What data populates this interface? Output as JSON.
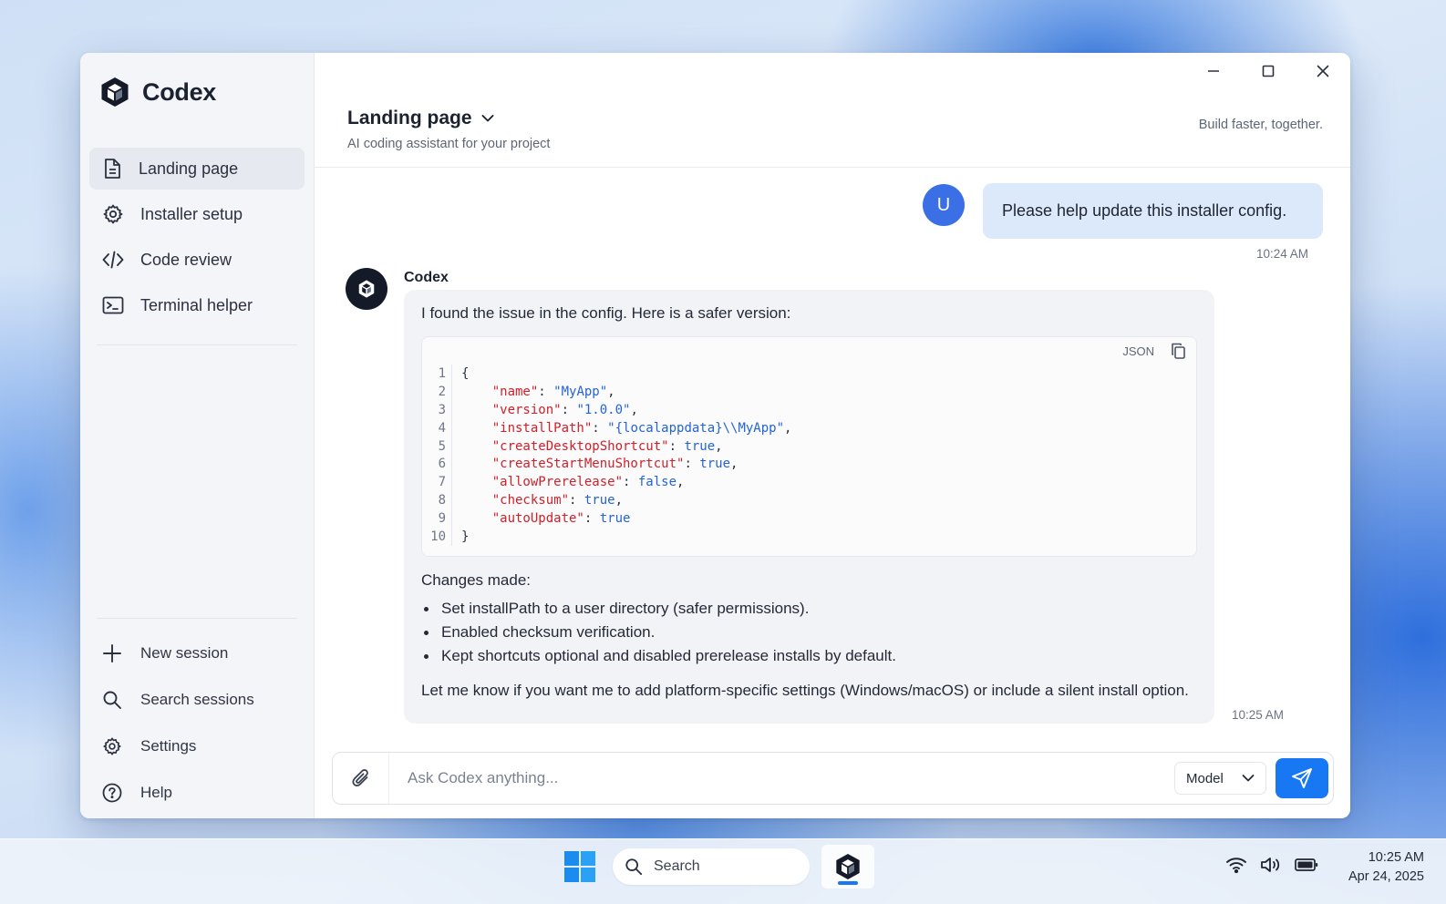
{
  "app": {
    "name": "Codex",
    "brand_color": "#141a27",
    "accent_color": "#1877f2"
  },
  "sidebar": {
    "nav": [
      {
        "label": "Landing page",
        "icon": "document-icon",
        "active": true
      },
      {
        "label": "Installer setup",
        "icon": "gear-icon",
        "active": false
      },
      {
        "label": "Code review",
        "icon": "code-icon",
        "active": false
      },
      {
        "label": "Terminal helper",
        "icon": "terminal-icon",
        "active": false
      }
    ],
    "bottom": [
      {
        "label": "New session",
        "icon": "plus-icon"
      },
      {
        "label": "Search sessions",
        "icon": "search-icon"
      },
      {
        "label": "Settings",
        "icon": "gear-icon"
      },
      {
        "label": "Help",
        "icon": "help-circle-icon"
      }
    ]
  },
  "header": {
    "title": "Landing page",
    "subtitle": "AI coding assistant for your project",
    "tagline": "Build faster, together."
  },
  "chat": {
    "user": {
      "avatar_letter": "U",
      "message": "Please help update this installer config.",
      "time": "10:24 AM"
    },
    "bot": {
      "name": "Codex",
      "intro": "I found the issue in the config. Here is a safer version:",
      "code_lang": "JSON",
      "code_lines": [
        {
          "n": "1",
          "tokens": [
            {
              "t": "p",
              "v": "{"
            }
          ]
        },
        {
          "n": "2",
          "tokens": [
            {
              "t": "p",
              "v": "    "
            },
            {
              "t": "k",
              "v": "\"name\""
            },
            {
              "t": "p",
              "v": ": "
            },
            {
              "t": "s",
              "v": "\"MyApp\""
            },
            {
              "t": "p",
              "v": ","
            }
          ]
        },
        {
          "n": "3",
          "tokens": [
            {
              "t": "p",
              "v": "    "
            },
            {
              "t": "k",
              "v": "\"version\""
            },
            {
              "t": "p",
              "v": ": "
            },
            {
              "t": "s",
              "v": "\"1.0.0\""
            },
            {
              "t": "p",
              "v": ","
            }
          ]
        },
        {
          "n": "4",
          "tokens": [
            {
              "t": "p",
              "v": "    "
            },
            {
              "t": "k",
              "v": "\"installPath\""
            },
            {
              "t": "p",
              "v": ": "
            },
            {
              "t": "s",
              "v": "\"{localappdata}\\\\MyApp\""
            },
            {
              "t": "p",
              "v": ","
            }
          ]
        },
        {
          "n": "5",
          "tokens": [
            {
              "t": "p",
              "v": "    "
            },
            {
              "t": "k",
              "v": "\"createDesktopShortcut\""
            },
            {
              "t": "p",
              "v": ": "
            },
            {
              "t": "b",
              "v": "true"
            },
            {
              "t": "p",
              "v": ","
            }
          ]
        },
        {
          "n": "6",
          "tokens": [
            {
              "t": "p",
              "v": "    "
            },
            {
              "t": "k",
              "v": "\"createStartMenuShortcut\""
            },
            {
              "t": "p",
              "v": ": "
            },
            {
              "t": "b",
              "v": "true"
            },
            {
              "t": "p",
              "v": ","
            }
          ]
        },
        {
          "n": "7",
          "tokens": [
            {
              "t": "p",
              "v": "    "
            },
            {
              "t": "k",
              "v": "\"allowPrerelease\""
            },
            {
              "t": "p",
              "v": ": "
            },
            {
              "t": "b",
              "v": "false"
            },
            {
              "t": "p",
              "v": ","
            }
          ]
        },
        {
          "n": "8",
          "tokens": [
            {
              "t": "p",
              "v": "    "
            },
            {
              "t": "k",
              "v": "\"checksum\""
            },
            {
              "t": "p",
              "v": ": "
            },
            {
              "t": "b",
              "v": "true"
            },
            {
              "t": "p",
              "v": ","
            }
          ]
        },
        {
          "n": "9",
          "tokens": [
            {
              "t": "p",
              "v": "    "
            },
            {
              "t": "k",
              "v": "\"autoUpdate\""
            },
            {
              "t": "p",
              "v": ": "
            },
            {
              "t": "b",
              "v": "true"
            }
          ]
        },
        {
          "n": "10",
          "tokens": [
            {
              "t": "p",
              "v": "}"
            }
          ]
        }
      ],
      "changes_title": "Changes made:",
      "changes": [
        "Set installPath to a user directory (safer permissions).",
        "Enabled checksum verification.",
        "Kept shortcuts optional and disabled prerelease installs by default."
      ],
      "closing": "Let me know if you want me to add platform-specific settings (Windows/macOS) or include a silent install option.",
      "time": "10:25 AM"
    }
  },
  "composer": {
    "placeholder": "Ask Codex anything...",
    "value": "",
    "model_label": "Model"
  },
  "taskbar": {
    "search_label": "Search",
    "time": "10:25 AM",
    "date": "Apr 24, 2025"
  }
}
